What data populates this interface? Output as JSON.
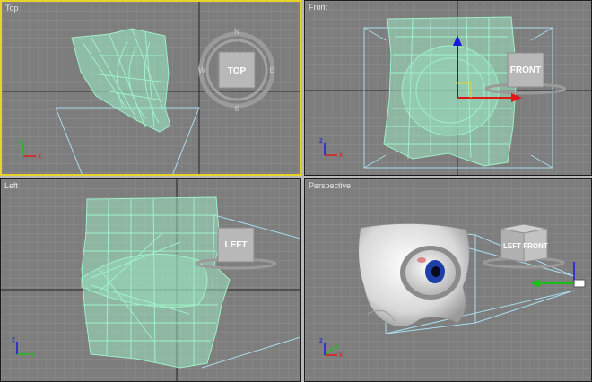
{
  "viewports": {
    "top": {
      "label": "Top",
      "cube_label": "TOP",
      "active": true
    },
    "front": {
      "label": "Front",
      "cube_label": "FRONT"
    },
    "left": {
      "label": "Left",
      "cube_label": "LEFT"
    },
    "perspective": {
      "label": "Perspective",
      "cube_labels": [
        "LEFT",
        "FRONT"
      ]
    }
  },
  "axis_labels": {
    "x": "x",
    "y": "y",
    "z": "z"
  },
  "compass_letters": {
    "n": "N",
    "s": "S",
    "w": "W",
    "e": "E"
  },
  "colors": {
    "wireframe": "#9ff0c8",
    "active_border": "#e6d42a",
    "camera_frustum": "#a9dcec",
    "gizmo_x": "#e01818",
    "gizmo_y": "#18c018",
    "gizmo_z": "#1818e0",
    "model_shaded": "#e6e6e6",
    "iris": "#1c3fa8"
  }
}
